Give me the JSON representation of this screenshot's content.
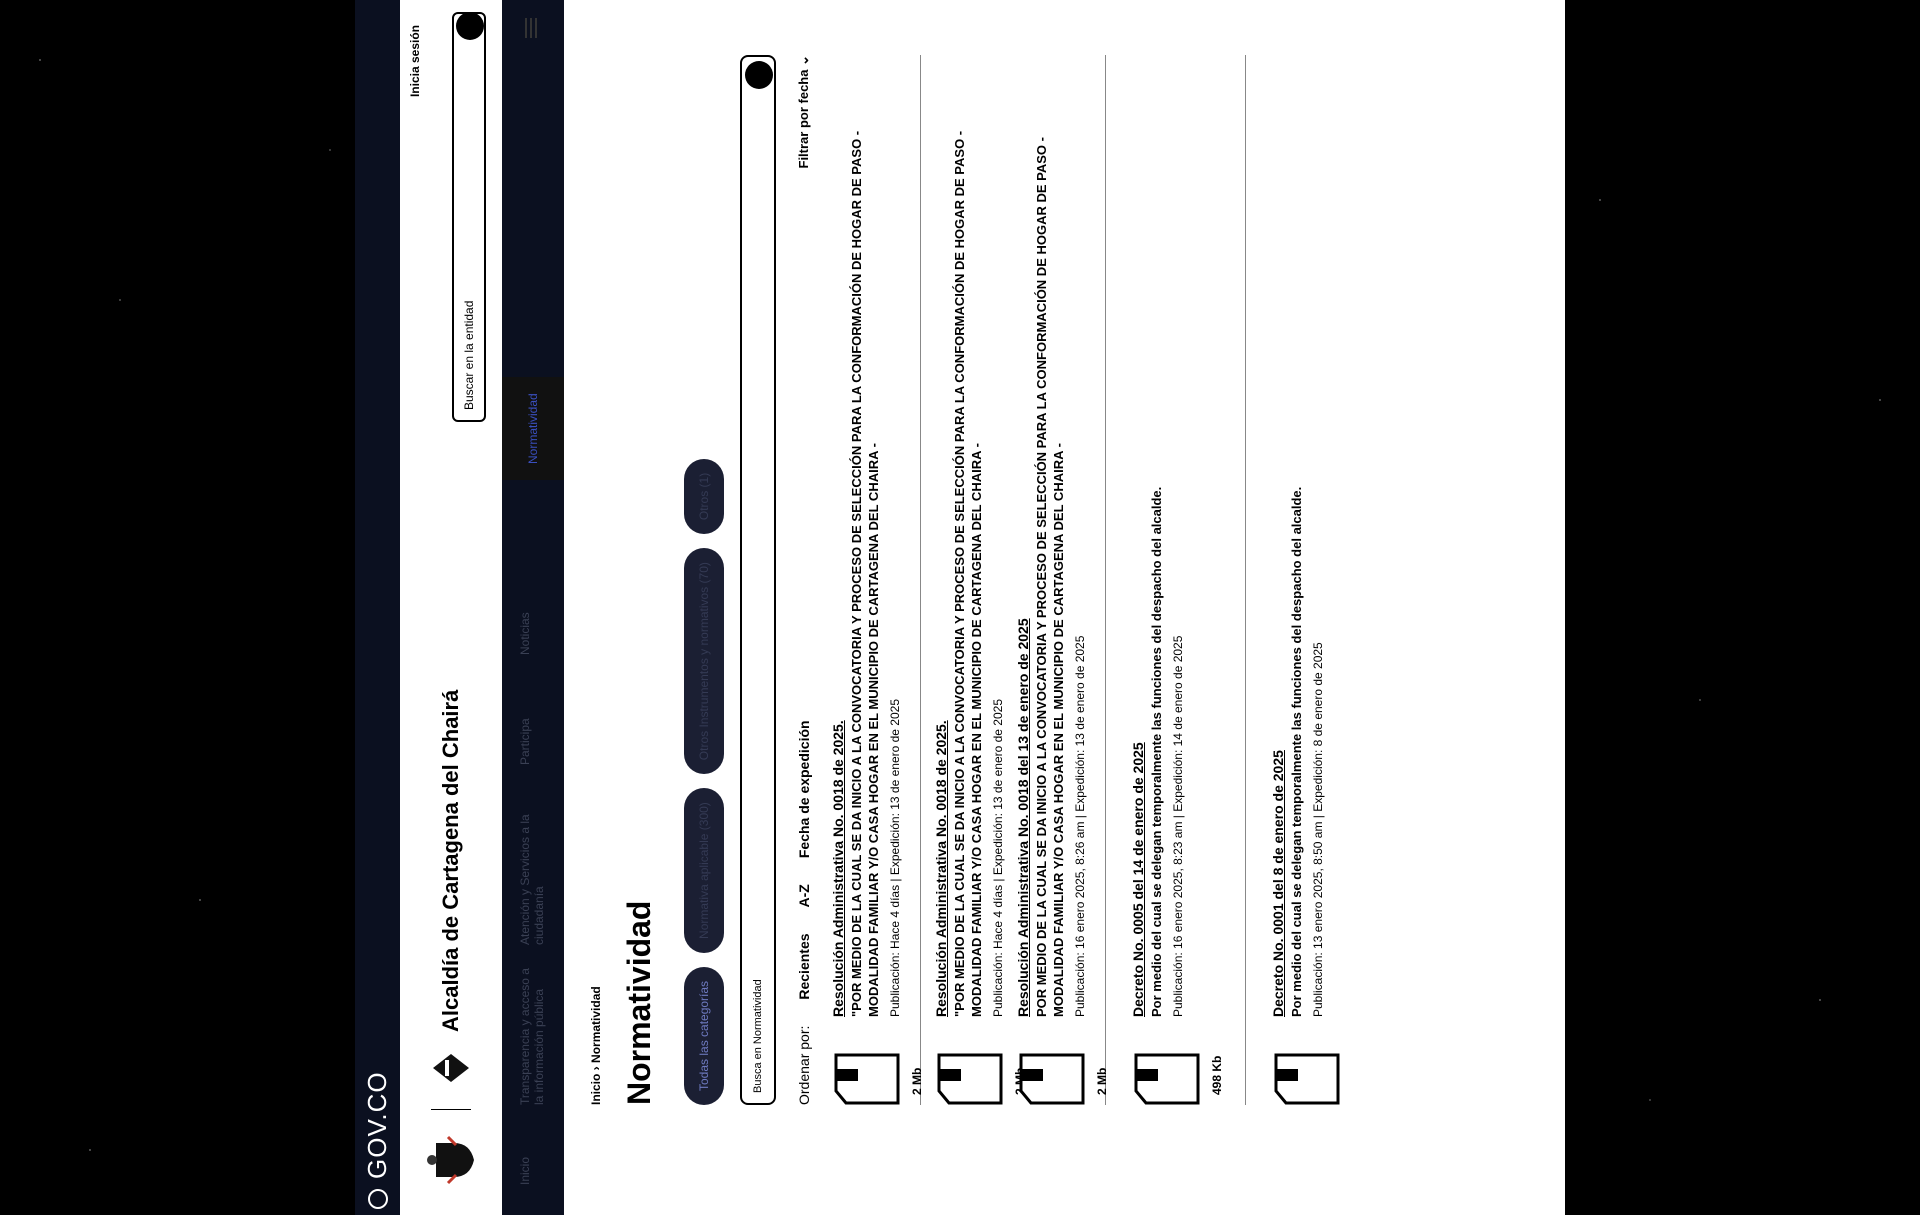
{
  "gov_bar": {
    "label": "GOV.CO"
  },
  "header": {
    "entity_title": "Alcaldía de Cartagena del Chairá",
    "login": "Inicia sesión",
    "search_placeholder": "Buscar en la entidad"
  },
  "nav": {
    "items": [
      "Inicio",
      "Transparencia y acceso a la información pública",
      "Atención y Servicios a la ciudadanía",
      "Participa",
      "Noticias",
      "Normatividad"
    ],
    "active": "Normatividad"
  },
  "breadcrumb": {
    "home": "Inicio",
    "separator": "›",
    "current": "Normatividad"
  },
  "page_title": "Normatividad",
  "chips": [
    "Todas las categorías",
    "Normativa aplicable (300)",
    "Otros Instrumentos y normativos (70)",
    "Otros (1)"
  ],
  "filter_search_placeholder": "Busca en Normatividad",
  "sort": {
    "label": "Ordenar por:",
    "options": [
      "Recientes",
      "A-Z",
      "Fecha de expedición"
    ],
    "date_filter": "Filtrar por fecha"
  },
  "documents": [
    {
      "title": "Resolución Administrativa No. 0018 de 2025.",
      "description": "\"POR MEDIO DE LA CUAL SE DA INICIO A LA CONVOCATORIA Y PROCESO DE SELECCIÓN PARA LA CONFORMACIÓN DE HOGAR DE PASO - MODALIDAD FAMILIAR Y/O CASA HOGAR EN EL MUNICIPIO DE CARTAGENA DEL CHAIRA -",
      "meta": "Publicación: Hace 4 días  |  Expedición: 13 de enero de 2025",
      "size": "2 Mb"
    },
    {
      "title": "Resolución Administrativa No. 0018 de 2025.",
      "description": "\"POR MEDIO DE LA CUAL SE DA INICIO A LA CONVOCATORIA Y PROCESO DE SELECCIÓN PARA LA CONFORMACIÓN DE HOGAR DE PASO - MODALIDAD FAMILIAR Y/O CASA HOGAR EN EL MUNICIPIO DE CARTAGENA DEL CHAIRA -",
      "meta": "Publicación: Hace 4 días  |  Expedición: 13 de enero de 2025",
      "size": "2 Mb"
    },
    {
      "title": "Resolución Administrativa No. 0018 del 13 de enero de 2025",
      "description": "POR MEDIO DE LA CUAL SE DA INICIO A LA CONVOCATORIA Y PROCESO DE SELECCIÓN PARA LA CONFORMACIÓN DE HOGAR DE PASO - MODALIDAD FAMILIAR Y/O CASA HOGAR EN EL MUNICIPIO DE CARTAGENA DEL CHAIRA -",
      "meta": "Publicación: 16 enero 2025, 8:26 am  |  Expedición: 13 de enero de 2025",
      "size": "2 Mb"
    },
    {
      "title": "Decreto No. 0005 del 14 de enero de 2025",
      "description": "Por medio del cual se delegan temporalmente las funciones del despacho del alcalde.",
      "meta": "Publicación: 16 enero 2025, 8:23 am  |  Expedición: 14 de enero de 2025",
      "size": "498 Kb"
    },
    {
      "title": "Decreto No. 0001 del 8 de enero de 2025",
      "description": "Por medio del cual se delegan temporalmente las funciones del despacho del alcalde.",
      "meta": "Publicación: 13 enero 2025, 8:50 am  |  Expedición: 8 de enero de 2025",
      "size": ""
    }
  ]
}
